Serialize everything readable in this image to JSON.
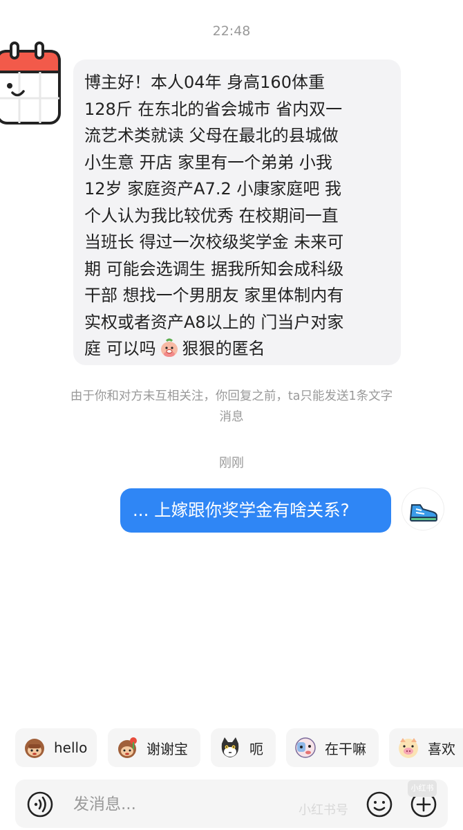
{
  "chat": {
    "timestamp_first": "22:48",
    "incoming_message": {
      "lines": [
        "博主好！本人04年 身高160体重",
        "128斤 在东北的省会城市 省内双一",
        "流艺术类就读 父母在最北的县城做",
        "小生意 开店 家里有一个弟弟 小我",
        "12岁 家庭资产A7.2 小康家庭吧 我",
        "个人认为我比较优秀 在校期间一直",
        "当班长 得过一次校级奖学金 未来可",
        "期 可能会选调生 据我所知会成科级",
        "干部 想找一个男朋友 家里体制内有",
        "实权或者资产A8以上的 门当户对家"
      ],
      "last_line_before_emoji": "庭 可以吗",
      "last_line_after_emoji": "狠狠的匿名",
      "inline_emoji": "peach-face-emoji"
    },
    "notice_lines": [
      "由于你和对方未互相关注，你回复之前，ta只能发送1条文字",
      "消息"
    ],
    "timestamp_second": "刚刚",
    "outgoing_message": "... 上嫁跟你奖学金有啥关系?"
  },
  "quick_replies": [
    {
      "label": "hello",
      "icon": "monkey-face-icon"
    },
    {
      "label": "谢谢宝",
      "icon": "monkey-flower-icon"
    },
    {
      "label": "呃",
      "icon": "black-cat-icon"
    },
    {
      "label": "在干嘛",
      "icon": "peeking-face-icon"
    },
    {
      "label": "喜欢",
      "icon": "pig-face-icon"
    }
  ],
  "input": {
    "placeholder": "发消息..."
  },
  "watermark": {
    "text": "小红书号",
    "logo": "小红书"
  },
  "colors": {
    "outgoing_bubble": "#2f86f5",
    "incoming_bubble": "#f3f3f5",
    "meta_text": "#999999"
  }
}
